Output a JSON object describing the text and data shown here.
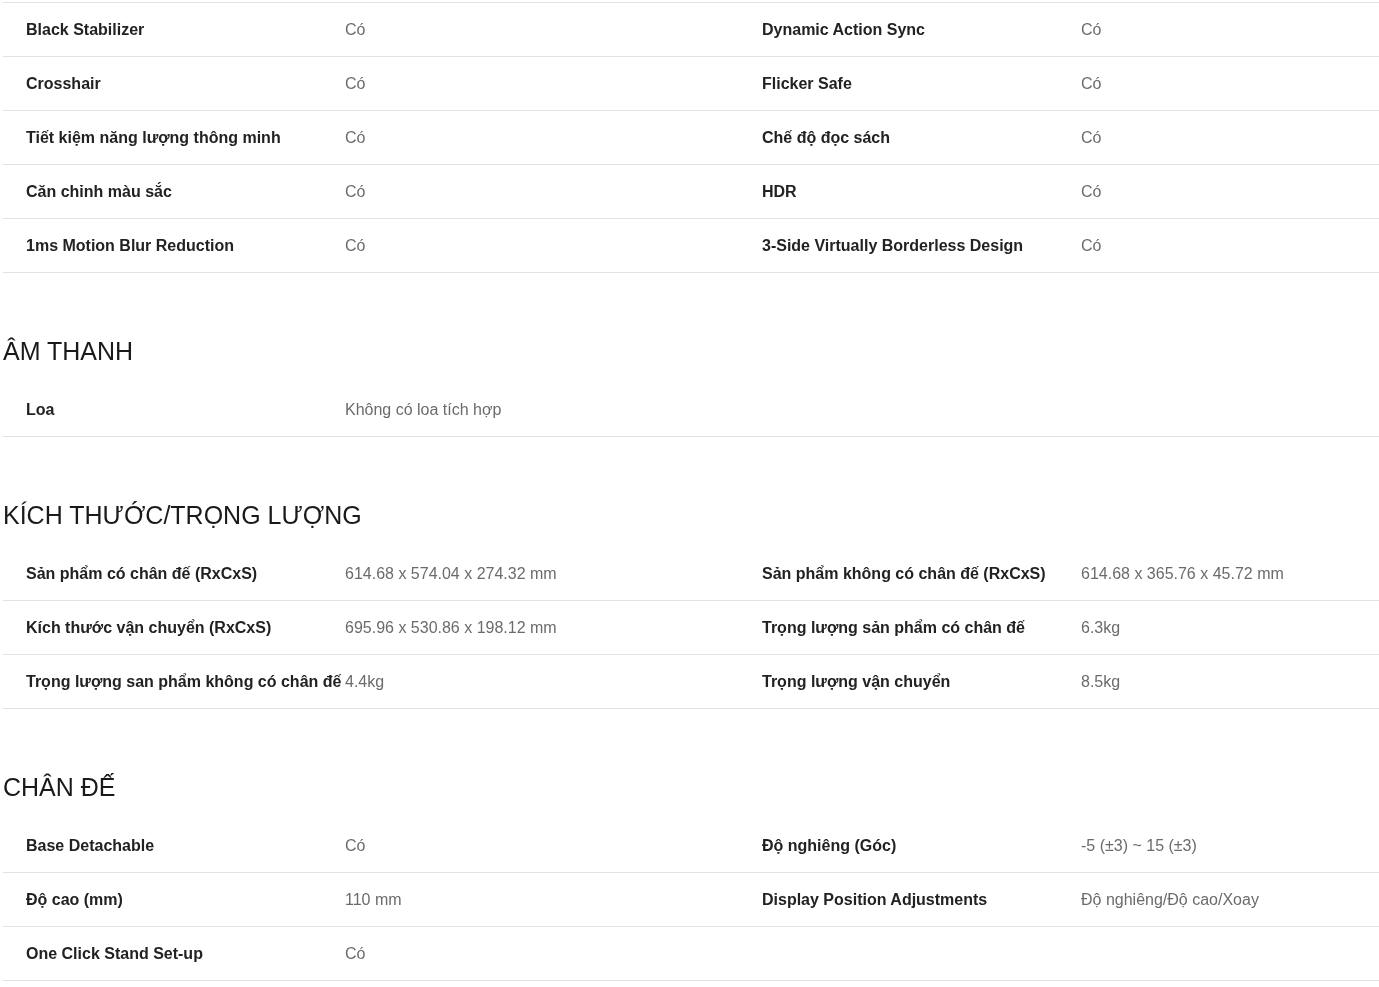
{
  "sections": [
    {
      "rows": [
        [
          {
            "label": "Black Stabilizer",
            "value": "Có"
          },
          {
            "label": "Dynamic Action Sync",
            "value": "Có"
          }
        ],
        [
          {
            "label": "Crosshair",
            "value": "Có"
          },
          {
            "label": "Flicker Safe",
            "value": "Có"
          }
        ],
        [
          {
            "label": "Tiết kiệm năng lượng thông minh",
            "value": "Có"
          },
          {
            "label": "Chế độ đọc sách",
            "value": "Có"
          }
        ],
        [
          {
            "label": "Căn chỉnh màu sắc",
            "value": "Có"
          },
          {
            "label": "HDR",
            "value": "Có"
          }
        ],
        [
          {
            "label": "1ms Motion Blur Reduction",
            "value": "Có"
          },
          {
            "label": "3-Side Virtually Borderless Design",
            "value": "Có"
          }
        ]
      ]
    },
    {
      "title": "ÂM THANH",
      "rows": [
        [
          {
            "label": "Loa",
            "value": "Không có loa tích hợp"
          }
        ]
      ]
    },
    {
      "title": "KÍCH THƯỚC/TRỌNG LƯỢNG",
      "rows": [
        [
          {
            "label": "Sản phẩm có chân đế (RxCxS)",
            "value": "614.68 x 574.04 x 274.32 mm"
          },
          {
            "label": "Sản phẩm không có chân đế (RxCxS)",
            "value": "614.68 x 365.76 x 45.72 mm"
          }
        ],
        [
          {
            "label": "Kích thước vận chuyển (RxCxS)",
            "value": "695.96 x 530.86 x 198.12 mm"
          },
          {
            "label": "Trọng lượng sản phẩm có chân đế",
            "value": "6.3kg"
          }
        ],
        [
          {
            "label": "Trọng lượng san phẩm không có chân đế",
            "value": "4.4kg"
          },
          {
            "label": "Trọng lượng vận chuyển",
            "value": "8.5kg"
          }
        ]
      ]
    },
    {
      "title": "CHÂN ĐẾ",
      "rows": [
        [
          {
            "label": "Base Detachable",
            "value": "Có"
          },
          {
            "label": "Độ nghiêng (Góc)",
            "value": "-5 (±3) ~ 15 (±3)"
          }
        ],
        [
          {
            "label": "Độ cao (mm)",
            "value": "110 mm"
          },
          {
            "label": "Display Position Adjustments",
            "value": "Độ nghiêng/Độ cao/Xoay"
          }
        ],
        [
          {
            "label": "One Click Stand Set-up",
            "value": "Có"
          }
        ]
      ]
    }
  ]
}
